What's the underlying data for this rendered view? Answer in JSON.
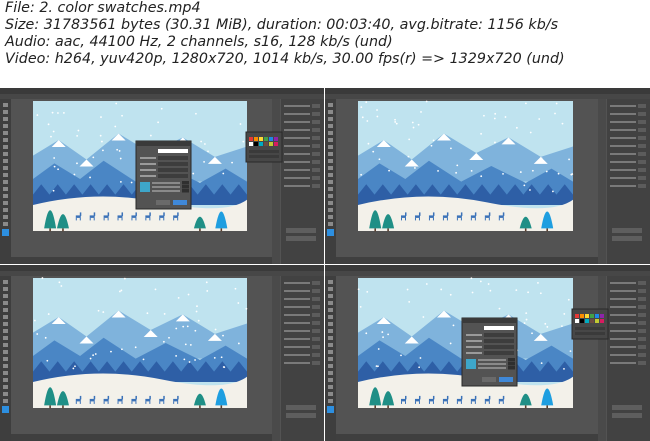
{
  "info": {
    "line1": "File: 2. color swatches.mp4",
    "line2": "Size: 31783561 bytes (30.31 MiB), duration: 00:03:40, avg.bitrate: 1156 kb/s",
    "line3": "Audio: aac, 44100 Hz, 2 channels, s16, 128 kb/s (und)",
    "line4": "Video: h264, yuv420p, 1280x720, 1014 kb/s, 30.00 fps(r) => 1329x720 (und)"
  },
  "frames": [
    {
      "name": "frame-1",
      "dialog": true,
      "swatch_popup": true,
      "deer_row": "upper"
    },
    {
      "name": "frame-2",
      "dialog": false,
      "swatch_popup": false,
      "deer_row": "upper"
    },
    {
      "name": "frame-3",
      "dialog": false,
      "swatch_popup": false,
      "deer_row": "lower"
    },
    {
      "name": "frame-4",
      "dialog": true,
      "swatch_popup": true,
      "deer_row": "lower"
    }
  ],
  "colors": {
    "ui_dark": "#535353",
    "ui_darker": "#3b3b3b",
    "sky": "#bfe3ef",
    "mountain_dark": "#2e5fa6",
    "mountain_mid": "#4a86c5",
    "mountain_light": "#7fb3dc",
    "snow": "#ffffff",
    "ground": "#f3f1ea",
    "tree_teal": "#1f8f86",
    "tree_blue": "#1e9ee0",
    "deer": "#3b72b8"
  }
}
